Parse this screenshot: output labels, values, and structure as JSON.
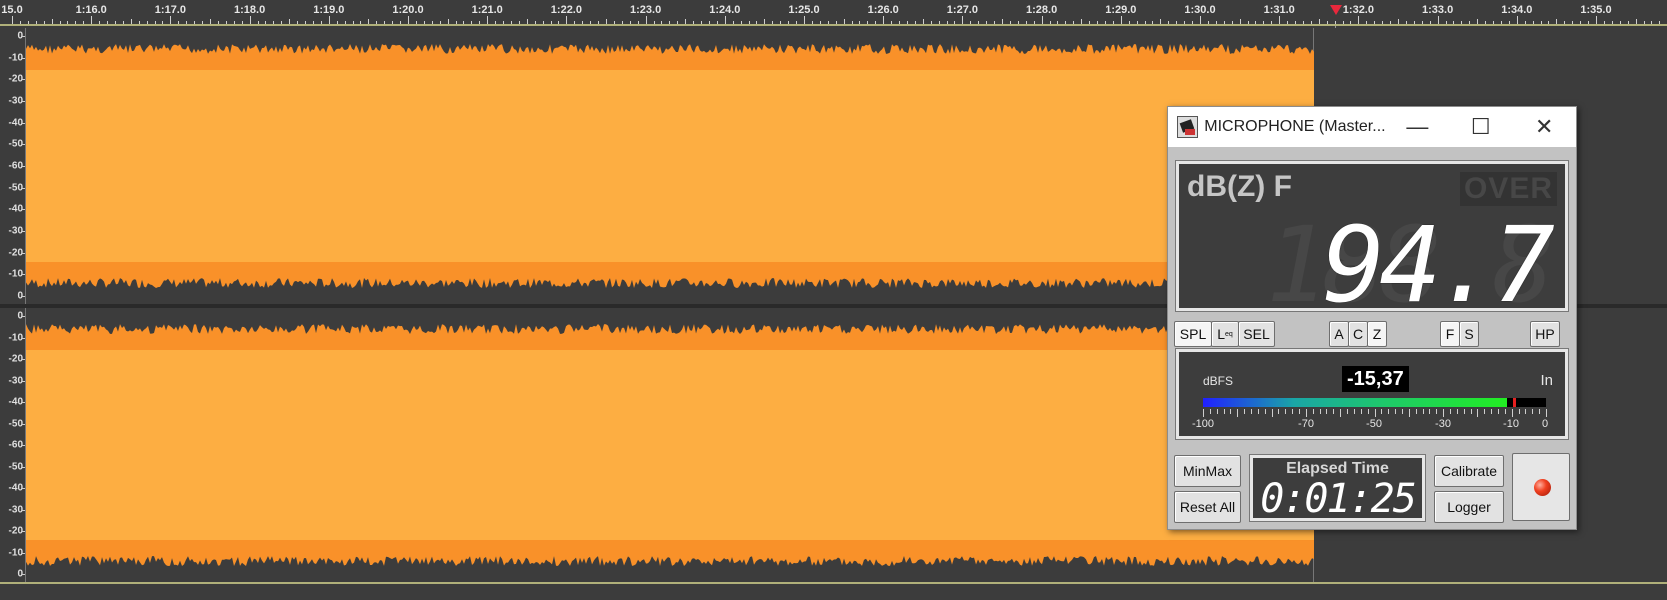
{
  "timeline": {
    "labels": [
      "15.0",
      "1:16.0",
      "1:17.0",
      "1:18.0",
      "1:19.0",
      "1:20.0",
      "1:21.0",
      "1:22.0",
      "1:23.0",
      "1:24.0",
      "1:25.0",
      "1:26.0",
      "1:27.0",
      "1:28.0",
      "1:29.0",
      "1:30.0",
      "1:31.0",
      "1:32.0",
      "1:33.0",
      "1:34.0",
      "1:35.0"
    ]
  },
  "track_scale": {
    "labels": [
      "0",
      "-10",
      "-20",
      "-30",
      "-40",
      "-50",
      "-60",
      "-50",
      "-40",
      "-30",
      "-20",
      "-10",
      "0"
    ]
  },
  "colors": {
    "waveform_fill": "#fdae42",
    "waveform_edge": "#f99129",
    "background": "#3c3c3c",
    "playhead": "#e8283c"
  },
  "meter": {
    "title": "MICROPHONE (Master...",
    "window_buttons": {
      "minimize": "—",
      "maximize": "☐",
      "close": "✕"
    },
    "weighting_label": "dB(Z) F",
    "over_label": "OVER",
    "ghost_digits": "188.8",
    "spl_value": "94.7",
    "mode_buttons": {
      "spl": "SPL",
      "leq": "L",
      "leq_sub": "eq",
      "sel": "SEL"
    },
    "weighting_buttons": {
      "a": "A",
      "c": "C",
      "z": "Z"
    },
    "time_buttons": {
      "f": "F",
      "s": "S"
    },
    "hp": "HP",
    "level": {
      "label": "dBFS",
      "value": "-15,37",
      "input_label": "In",
      "bar_fill_percent": 88.5,
      "peak_percent": 90.5,
      "scale_labels": [
        "-100",
        "-70",
        "-50",
        "-30",
        "-10",
        "0"
      ]
    },
    "minmax": "MinMax",
    "reset_all": "Reset All",
    "elapsed_title": "Elapsed Time",
    "elapsed_value": "0:01:25",
    "calibrate": "Calibrate",
    "logger": "Logger"
  }
}
